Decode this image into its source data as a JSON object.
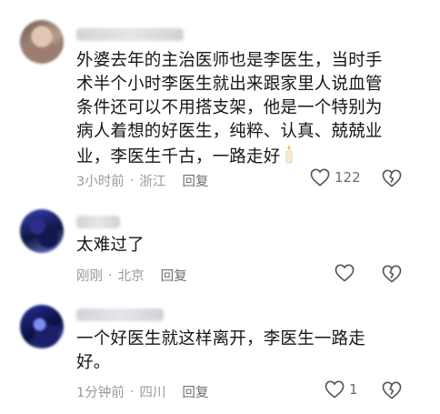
{
  "comments": [
    {
      "text": "外婆去年的主治医师也是李医生，当时手术半个小时李医生就出来跟家里人说血管条件还可以不用搭支架，他是一个特别为病人着想的好医生，纯粹、认真、兢兢业业，李医生千古，一路走好",
      "emoji": "candle-emoji",
      "time": "3小时前",
      "location": "浙江",
      "reply_label": "回复",
      "likes": "122"
    },
    {
      "text": "太难过了",
      "time": "刚刚",
      "location": "北京",
      "reply_label": "回复",
      "likes": ""
    },
    {
      "text": "一个好医生就这样离开，李医生一路走好。",
      "time": "1分钟前",
      "location": "四川",
      "reply_label": "回复",
      "likes": "1"
    }
  ],
  "separator": "·",
  "icons": {
    "like": "heart-outline-icon",
    "dislike": "broken-heart-icon"
  }
}
